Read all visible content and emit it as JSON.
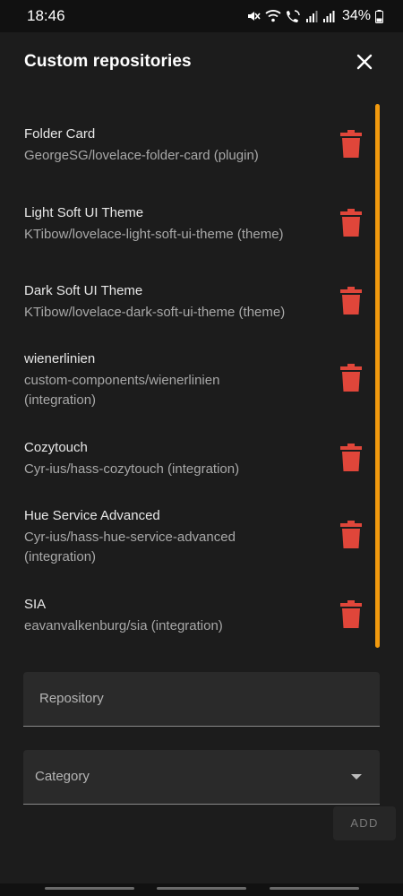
{
  "status_bar": {
    "time": "18:46",
    "battery": "34%"
  },
  "dialog": {
    "title": "Custom repositories",
    "repositories": [
      {
        "name": "Folder Card",
        "path": "GeorgeSG/lovelace-folder-card (plugin)"
      },
      {
        "name": "Light Soft UI Theme",
        "path": "KTibow/lovelace-light-soft-ui-theme (theme)"
      },
      {
        "name": "Dark Soft UI Theme",
        "path": "KTibow/lovelace-dark-soft-ui-theme (theme)"
      },
      {
        "name": "wienerlinien",
        "path": "custom-components/wienerlinien (integration)"
      },
      {
        "name": "Cozytouch",
        "path": "Cyr-ius/hass-cozytouch (integration)"
      },
      {
        "name": "Hue Service Advanced",
        "path": "Cyr-ius/hass-hue-service-advanced (integration)"
      },
      {
        "name": "SIA",
        "path": "eavanvalkenburg/sia (integration)"
      }
    ],
    "repository_field": {
      "label": "Repository"
    },
    "category_field": {
      "label": "Category"
    },
    "add_button": "ADD"
  },
  "colors": {
    "accent_scrollbar": "#f29a0e",
    "delete_icon": "#e0463a",
    "background": "#1c1c1c"
  }
}
